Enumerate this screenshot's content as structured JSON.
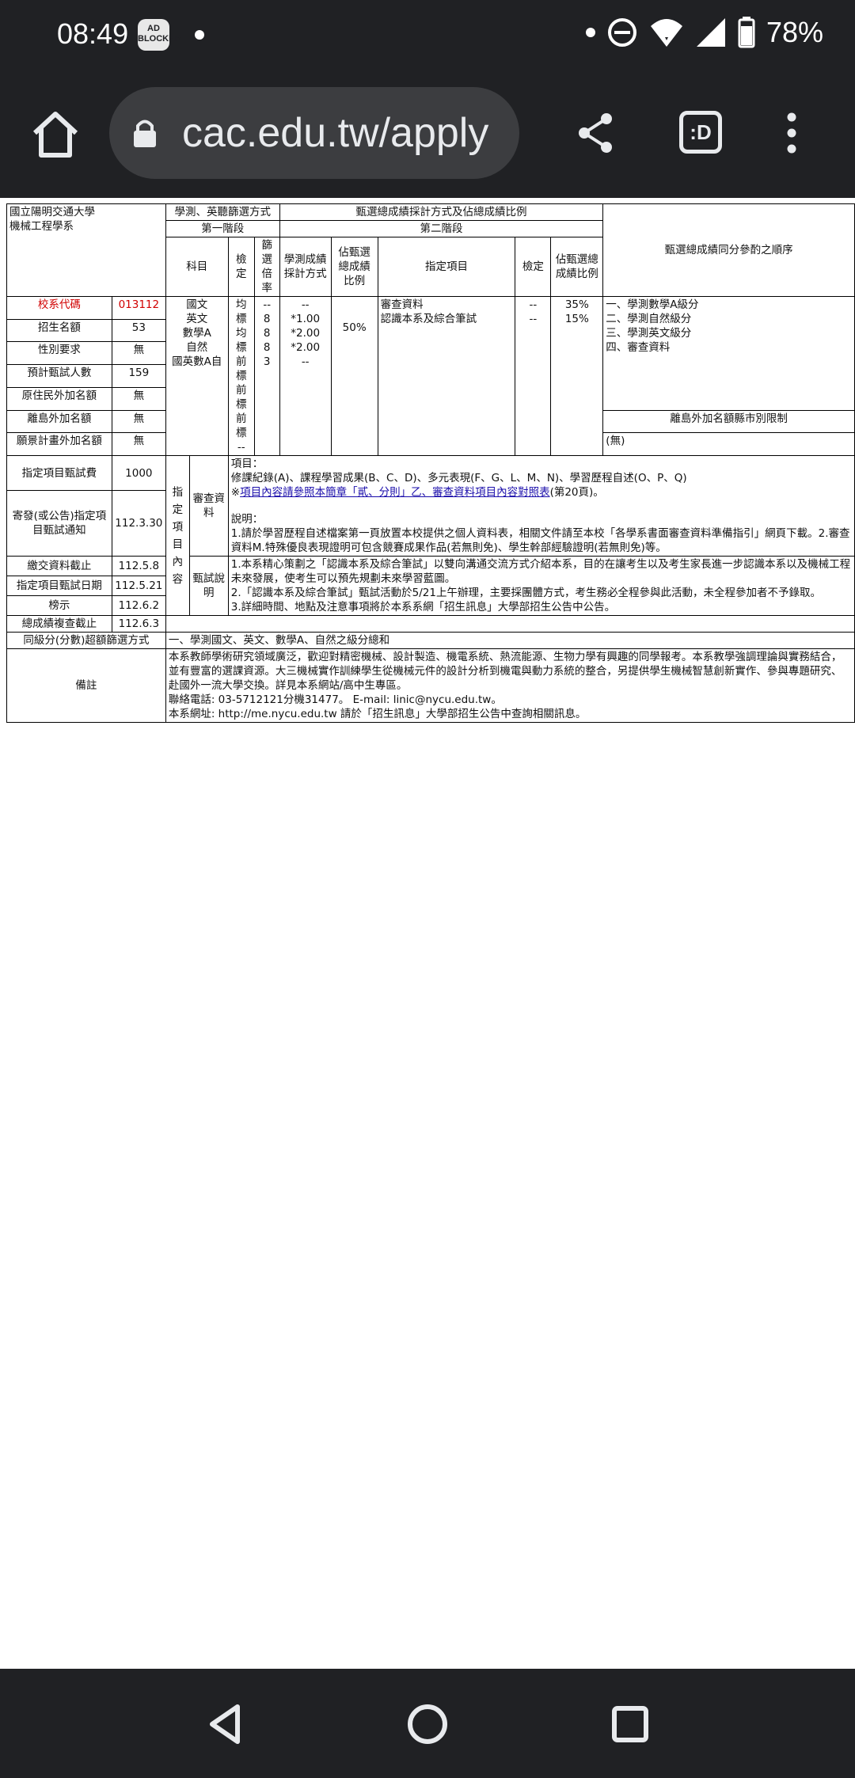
{
  "status_bar": {
    "time": "08:49",
    "adblock_badge": "AD\nBLOCKER",
    "battery": "78%"
  },
  "browser": {
    "url": "cac.edu.tw/apply",
    "tabs_label": ":D"
  },
  "page": {
    "school": "國立陽明交通大學",
    "department": "機械工程學系",
    "h_stage1_title": "學測、英聽篩選方式",
    "h_stage1": "第一階段",
    "h_subject": "科目",
    "h_check": "檢定",
    "h_ratio": "篩選倍率",
    "h_scores_method_title": "甄選總成績採計方式及佔總成績比例",
    "h_stage2": "第二階段",
    "h_method": "學測成績採計方式",
    "h_share": "佔甄選總成績比例",
    "h_item": "指定項目",
    "h_check2": "檢定",
    "h_share2": "佔甄選總成績比例",
    "h_order": "甄選總成績同分參酌之順序",
    "info_rows": [
      {
        "label": "校系代碼",
        "value": "013112"
      },
      {
        "label": "招生名額",
        "value": "53"
      },
      {
        "label": "性別要求",
        "value": "無"
      },
      {
        "label": "預計甄試人數",
        "value": "159"
      },
      {
        "label": "原住民外加名額",
        "value": "無"
      },
      {
        "label": "離島外加名額",
        "value": "無"
      },
      {
        "label": "願景計畫外加名額",
        "value": "無"
      }
    ],
    "subjects": [
      "國文",
      "英文",
      "數學A",
      "自然",
      "國英數A自"
    ],
    "checks": [
      "均標",
      "均標",
      "前標",
      "前標",
      "前標",
      "--"
    ],
    "ratios": [
      "--",
      "8",
      "8",
      "8",
      "3"
    ],
    "methods": [
      "--",
      "*1.00",
      "*2.00",
      "*2.00",
      "--"
    ],
    "method_share": "50%",
    "items": [
      "審查資料",
      "認識本系及綜合筆試"
    ],
    "item_checks": [
      "--",
      "--"
    ],
    "item_shares": [
      "35%",
      "15%"
    ],
    "tie_order": [
      "一、學測數學A級分",
      "二、學測自然級分",
      "三、學測英文級分",
      "四、審查資料"
    ],
    "island_title": "離島外加名額縣市別限制",
    "island_value": "(無)",
    "fee_label": "指定項目甄試費",
    "fee_value": "1000",
    "dates": [
      {
        "label": "寄發(或公告)指定項目甄試通知",
        "value": "112.3.30"
      },
      {
        "label": "繳交資料截止",
        "value": "112.5.8"
      },
      {
        "label": "指定項目甄試日期",
        "value": "112.5.21"
      },
      {
        "label": "榜示",
        "value": "112.6.2"
      },
      {
        "label": "總成績複查截止",
        "value": "112.6.3"
      }
    ],
    "vertical_label": "指定項目內容",
    "review_label": "審查資料",
    "review_items_title": "項目：",
    "review_items": "修課紀錄(A)、課程學習成果(B、C、D)、多元表現(F、G、L、M、N)、學習歷程自述(O、P、Q)",
    "review_link_prefix": "※",
    "review_link": "項目內容請參照本簡章「貳、分則」乙、審查資料項目內容對照表",
    "review_link_suffix": "(第20頁)。",
    "review_note_title": "說明：",
    "review_note": "1.請於學習歷程自述檔案第一頁放置本校提供之個人資料表，相關文件請至本校「各學系書面審查資料準備指引」網頁下載。2.審查資料M.特殊優良表現證明可包含競賽成果作品(若無則免)、學生幹部經驗證明(若無則免)等。",
    "exam_label": "甄試說明",
    "exam_notes": [
      "1.本系精心策劃之「認識本系及綜合筆試」以雙向溝通交流方式介紹本系，目的在讓考生以及考生家長進一步認識本系以及機械工程未來發展，使考生可以預先規劃未來學習藍圖。",
      "2.「認識本系及綜合筆試」甄試活動於5/21上午辦理，主要採團體方式，考生務必全程參與此活動，未全程參加者不予錄取。",
      "3.詳細時間、地點及注意事項將於本系系網「招生訊息」大學部招生公告中公告。"
    ],
    "tie_excess_label": "同級分(分數)超額篩選方式",
    "tie_excess_value": "一、學測國文、英文、數學A、自然之級分總和",
    "remarks_label": "備註",
    "remarks": [
      "本系教師學術研究領域廣泛，歡迎對精密機械、設計製造、機電系統、熱流能源、生物力學有興趣的同學報考。本系教學強調理論與實務結合，並有豐富的選課資源。大三機械實作訓練學生從機械元件的設計分析到機電與動力系統的整合，另提供學生機械智慧創新實作、參與專題研究、赴國外一流大學交換。詳見本系網站/高中生專區。",
      "聯絡電話: 03-5712121分機31477。 E-mail: linic@nycu.edu.tw。",
      "本系網址: http://me.nycu.edu.tw 請於「招生訊息」大學部招生公告中查詢相關訊息。"
    ]
  }
}
